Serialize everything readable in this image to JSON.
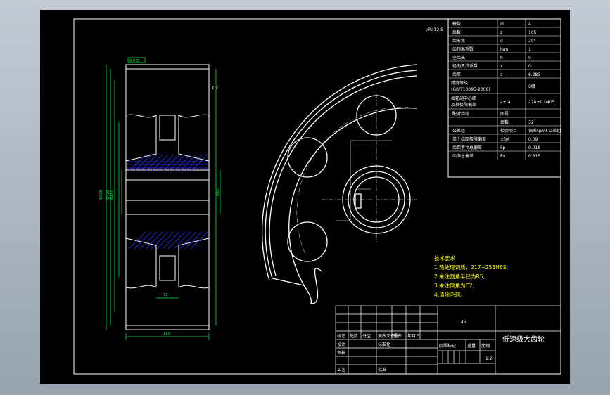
{
  "drawing": {
    "part_title": "低速级大齿轮",
    "scale": "1:2",
    "roughness_note": "√Ra12.5",
    "center_mark": "45"
  },
  "gear_table": {
    "rows": [
      {
        "label": "模数",
        "symbol": "m",
        "value": "4"
      },
      {
        "label": "齿数",
        "symbol": "z",
        "value": "105"
      },
      {
        "label": "齿形角",
        "symbol": "α",
        "value": "20°"
      },
      {
        "label": "齿顶高系数",
        "symbol": "han",
        "value": "1"
      },
      {
        "label": "全齿高",
        "symbol": "h",
        "value": "9"
      },
      {
        "label": "径向变位系数",
        "symbol": "x",
        "value": "0"
      },
      {
        "label": "齿厚",
        "symbol": "s",
        "value": "6.283"
      },
      {
        "label": "精度等级",
        "label2": "(GB/T10095-2008)",
        "symbol": "",
        "value": "8级"
      },
      {
        "label": "齿轮副中心距",
        "label2": "及其极限偏差",
        "symbol": "a±fa",
        "value": "274±0.0405"
      },
      {
        "label": "配对齿轮",
        "symbol": "图号",
        "value": ""
      },
      {
        "label": "",
        "symbol": "齿数",
        "value": "32"
      },
      {
        "label": "公差组",
        "symbol": "检验项目",
        "value": "偏差(μm) 公差组"
      },
      {
        "label": "单个齿距极限偏差",
        "symbol": "±fpt",
        "value": "0.09"
      },
      {
        "label": "齿距累计总偏差",
        "symbol": "Fp",
        "value": "0.018"
      },
      {
        "label": "齿廓总偏差",
        "symbol": "Fα",
        "value": "0.315"
      }
    ]
  },
  "tech_requirements": {
    "heading": "技术要求",
    "items": [
      "1.热处理调质，217~255HBS;",
      "2.未注圆角半径为R5;",
      "3.未注倒角为C2;",
      "4.清除毛刺。"
    ]
  },
  "title_block": {
    "labels": [
      "标记",
      "处数",
      "分区",
      "更改文件号",
      "签名",
      "年月日",
      "设计",
      "标准化",
      "阶段标记",
      "重量",
      "比例",
      "审核",
      "工艺",
      "批准"
    ]
  },
  "dimensions": {
    "face_width": "110",
    "hub_width": "72",
    "left_dims": [
      "Φ428",
      "Φ420",
      "Φ411",
      "Φ250",
      "Φ180"
    ],
    "right_dims": [
      "Φ65",
      "Φ411"
    ],
    "callouts": [
      "0.035",
      "0.022",
      "R5",
      "C2",
      "22",
      "74.9"
    ]
  },
  "colors": {
    "background": "#000000",
    "lines": "#ffffff",
    "dimension": "#00ff3c",
    "hatch": "#3030ff",
    "note": "#ffff00"
  }
}
